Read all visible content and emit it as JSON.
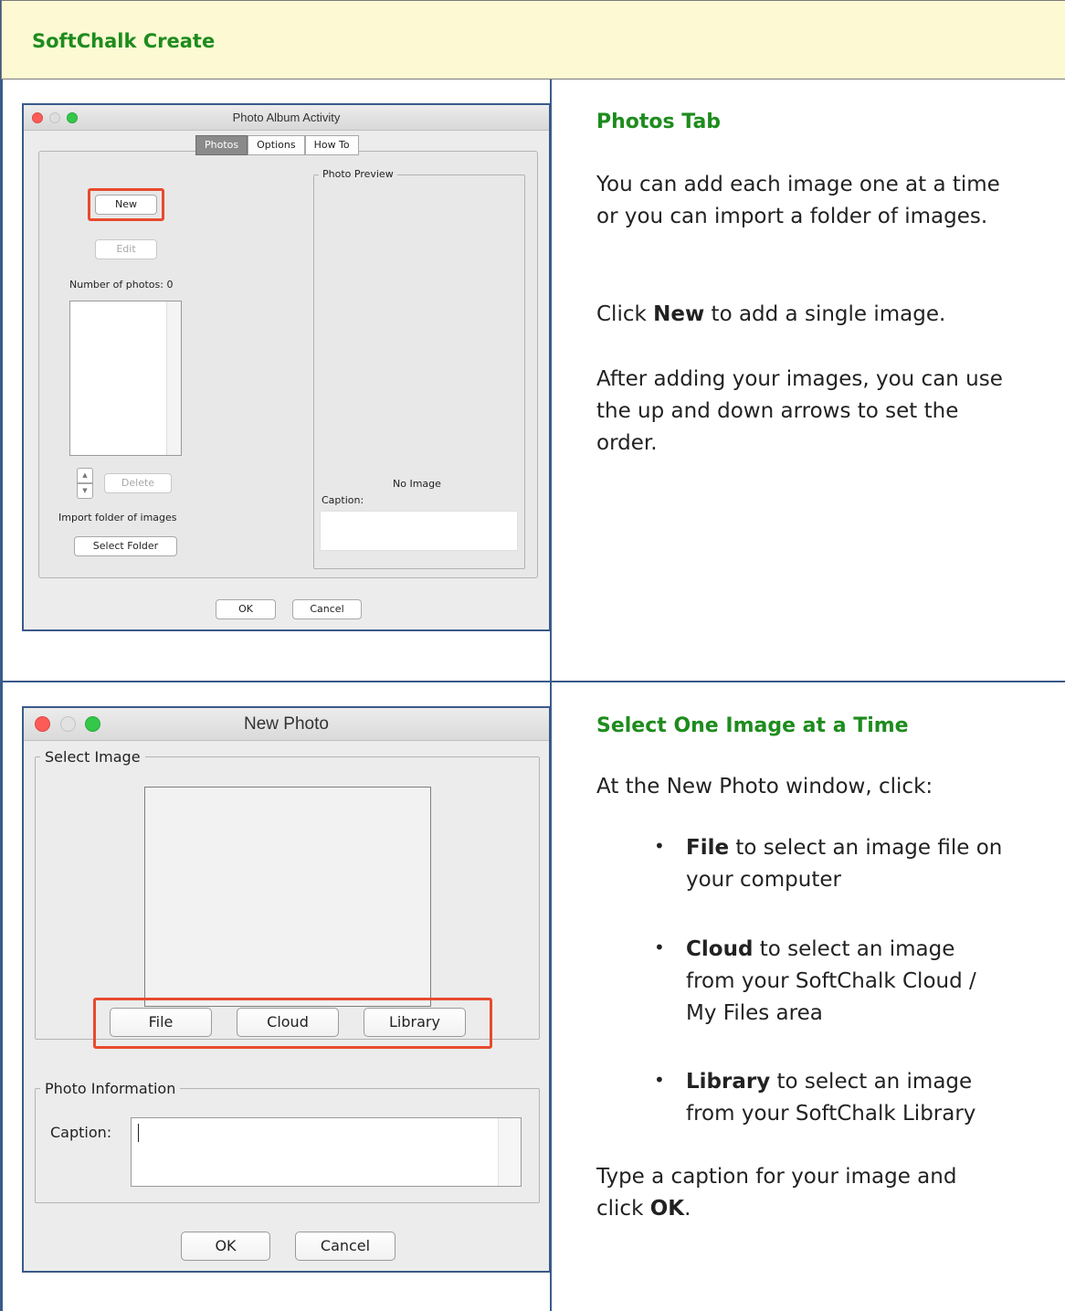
{
  "header": {
    "title": "SoftChalk Create"
  },
  "window1": {
    "title": "Photo Album Activity",
    "tabs": [
      "Photos",
      "Options",
      "How To"
    ],
    "new_button": "New",
    "edit_button": "Edit",
    "photo_count_label": "Number of photos: 0",
    "delete_button": "Delete",
    "import_label": "Import folder of images",
    "select_folder_button": "Select Folder",
    "preview_legend": "Photo Preview",
    "no_image": "No Image",
    "caption_label": "Caption:",
    "ok_button": "OK",
    "cancel_button": "Cancel",
    "up_arrow": "▲",
    "down_arrow": "▼"
  },
  "section1": {
    "heading": "Photos Tab",
    "para1": "You can add each image one at a time or you can import a folder of images.",
    "para2_prefix": "Click ",
    "para2_bold": "New",
    "para2_suffix": " to add a single image.",
    "para3": "After adding your images, you can use the up and down arrows to set the order."
  },
  "window2": {
    "title": "New Photo",
    "select_image_legend": "Select Image",
    "file_button": "File",
    "cloud_button": "Cloud",
    "library_button": "Library",
    "photo_info_legend": "Photo Information",
    "caption_label": "Caption:",
    "caption_value": "",
    "ok_button": "OK",
    "cancel_button": "Cancel"
  },
  "section2": {
    "heading": "Select One Image at a Time",
    "intro": "At the New Photo window, click:",
    "bullets": [
      {
        "bold": "File",
        "text_line1": " to select an image file on",
        "text_line2": "your computer"
      },
      {
        "bold": "Cloud",
        "text_line1": " to select an image",
        "text_line2": "from your SoftChalk Cloud /",
        "text_line3": "My Files area"
      },
      {
        "bold": "Library",
        "text_line1": " to select an image",
        "text_line2": "from your SoftChalk Library"
      }
    ],
    "bullet_char": "•",
    "outro_line1": "Type a caption for your image and",
    "outro_prefix": "click ",
    "outro_bold": "OK",
    "outro_suffix": "."
  },
  "colors": {
    "heading_green": "#1e8c1e",
    "header_bg": "#fdfad3",
    "border_blue": "#3a5a8a",
    "highlight_red": "#e84a2e",
    "close_red": "#fc5b57",
    "minimize_gray": "#d6d6d6",
    "zoom_green": "#34c84a"
  }
}
